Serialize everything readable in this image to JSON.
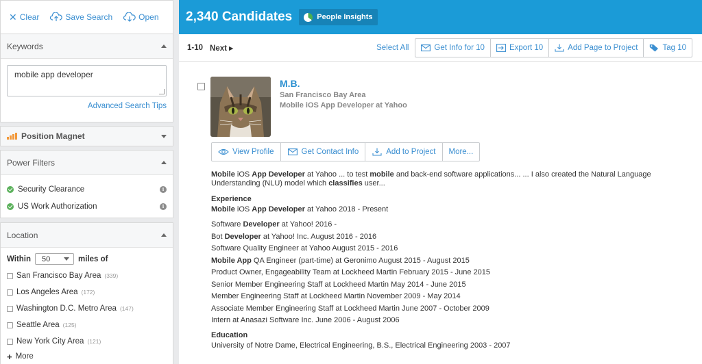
{
  "sidebar": {
    "top_actions": {
      "clear": "Clear",
      "save_search": "Save Search",
      "open": "Open"
    },
    "keywords": {
      "title": "Keywords",
      "value": "mobile app developer",
      "advanced_link": "Advanced Search Tips"
    },
    "position_magnet": {
      "title": "Position Magnet"
    },
    "power_filters": {
      "title": "Power Filters",
      "items": [
        {
          "label": "Security Clearance"
        },
        {
          "label": "US Work Authorization"
        }
      ]
    },
    "location": {
      "title": "Location",
      "within_label": "Within",
      "miles_value": "50",
      "miles_label": "miles of",
      "items": [
        {
          "label": "San Francisco Bay Area",
          "count": "(339)"
        },
        {
          "label": "Los Angeles Area",
          "count": "(172)"
        },
        {
          "label": "Washington D.C. Metro Area",
          "count": "(147)"
        },
        {
          "label": "Seattle Area",
          "count": "(125)"
        },
        {
          "label": "New York City Area",
          "count": "(121)"
        }
      ],
      "more": "More"
    }
  },
  "main": {
    "header": {
      "title": "2,340 Candidates",
      "insights": "People Insights"
    },
    "toolbar": {
      "range": "1-10",
      "next": "Next ▸",
      "select_all": "Select All",
      "get_info": "Get Info for 10",
      "export": "Export 10",
      "add_page": "Add Page to Project",
      "tag": "Tag 10"
    },
    "candidate": {
      "name": "M.B.",
      "location": "San Francisco Bay Area",
      "headline": "Mobile iOS App Developer at Yahoo",
      "actions": {
        "view_profile": "View Profile",
        "get_contact": "Get Contact Info",
        "add_project": "Add to Project",
        "more": "More..."
      },
      "snippet": {
        "b1": "Mobile",
        "t1": " iOS ",
        "b2": "App Developer",
        "t2": " at Yahoo ... to test ",
        "b3": "mobile",
        "t3": " and back-end software applications... ... I also created the Natural Language Understanding (NLU) model which ",
        "b4": "classifies",
        "t4": " user..."
      },
      "experience_title": "Experience",
      "current": {
        "b1": "Mobile",
        "t1": " iOS ",
        "b2": "App Developer",
        "t2": " at Yahoo 2018 - Present"
      },
      "history": [
        {
          "pre": "Software ",
          "bold": "Developer",
          "post": " at Yahoo! 2016 -"
        },
        {
          "pre": "Bot ",
          "bold": "Developer",
          "post": " at Yahoo! Inc. August 2016 - 2016"
        },
        {
          "pre": "Software Quality Engineer at Yahoo August 2015 - 2016",
          "bold": "",
          "post": ""
        },
        {
          "pre": "",
          "bold": "Mobile App",
          "post": " QA Engineer (part-time) at Geronimo August 2015 - August 2015"
        },
        {
          "pre": "Product Owner, Engageability Team at Lockheed Martin February 2015 - June 2015",
          "bold": "",
          "post": ""
        },
        {
          "pre": "Senior Member Engineering Staff at Lockheed Martin May 2014 - June 2015",
          "bold": "",
          "post": ""
        },
        {
          "pre": "Member Engineering Staff at Lockheed Martin November 2009 - May 2014",
          "bold": "",
          "post": ""
        },
        {
          "pre": "Associate Member Engineering Staff at Lockheed Martin June 2007 - October 2009",
          "bold": "",
          "post": ""
        },
        {
          "pre": "Intern at Anasazi Software Inc. June 2006 - August 2006",
          "bold": "",
          "post": ""
        }
      ],
      "education_title": "Education",
      "education": "University of Notre Dame, Electrical Engineering, B.S., Electrical Engineering 2003 - 2007"
    }
  },
  "colors": {
    "accent": "#1b9bd7",
    "link": "#3b8fd1",
    "check": "#5bb15b",
    "magnet": "#f2993b"
  }
}
